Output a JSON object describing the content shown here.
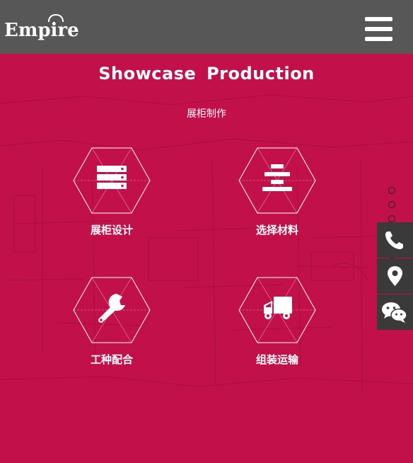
{
  "header": {
    "logo_text": "Empire",
    "menu_icon": "hamburger-menu-icon"
  },
  "section": {
    "title": "Showcase  Production",
    "subtitle": "展柜制作"
  },
  "features": [
    {
      "label": "展柜设计",
      "icon": "server-stack-icon"
    },
    {
      "label": "选择材料",
      "icon": "align-center-icon"
    },
    {
      "label": "工种配合",
      "icon": "wrench-icon"
    },
    {
      "label": "组装运输",
      "icon": "truck-icon"
    }
  ],
  "pagination": {
    "count": 7,
    "active_index": 4
  },
  "side_actions": [
    {
      "icon": "phone-icon"
    },
    {
      "icon": "map-marker-icon"
    },
    {
      "icon": "wechat-icon"
    }
  ],
  "colors": {
    "header_bg": "#575757",
    "accent_bg": "#c2114a",
    "side_bar_bg": "#3a3a3a"
  }
}
